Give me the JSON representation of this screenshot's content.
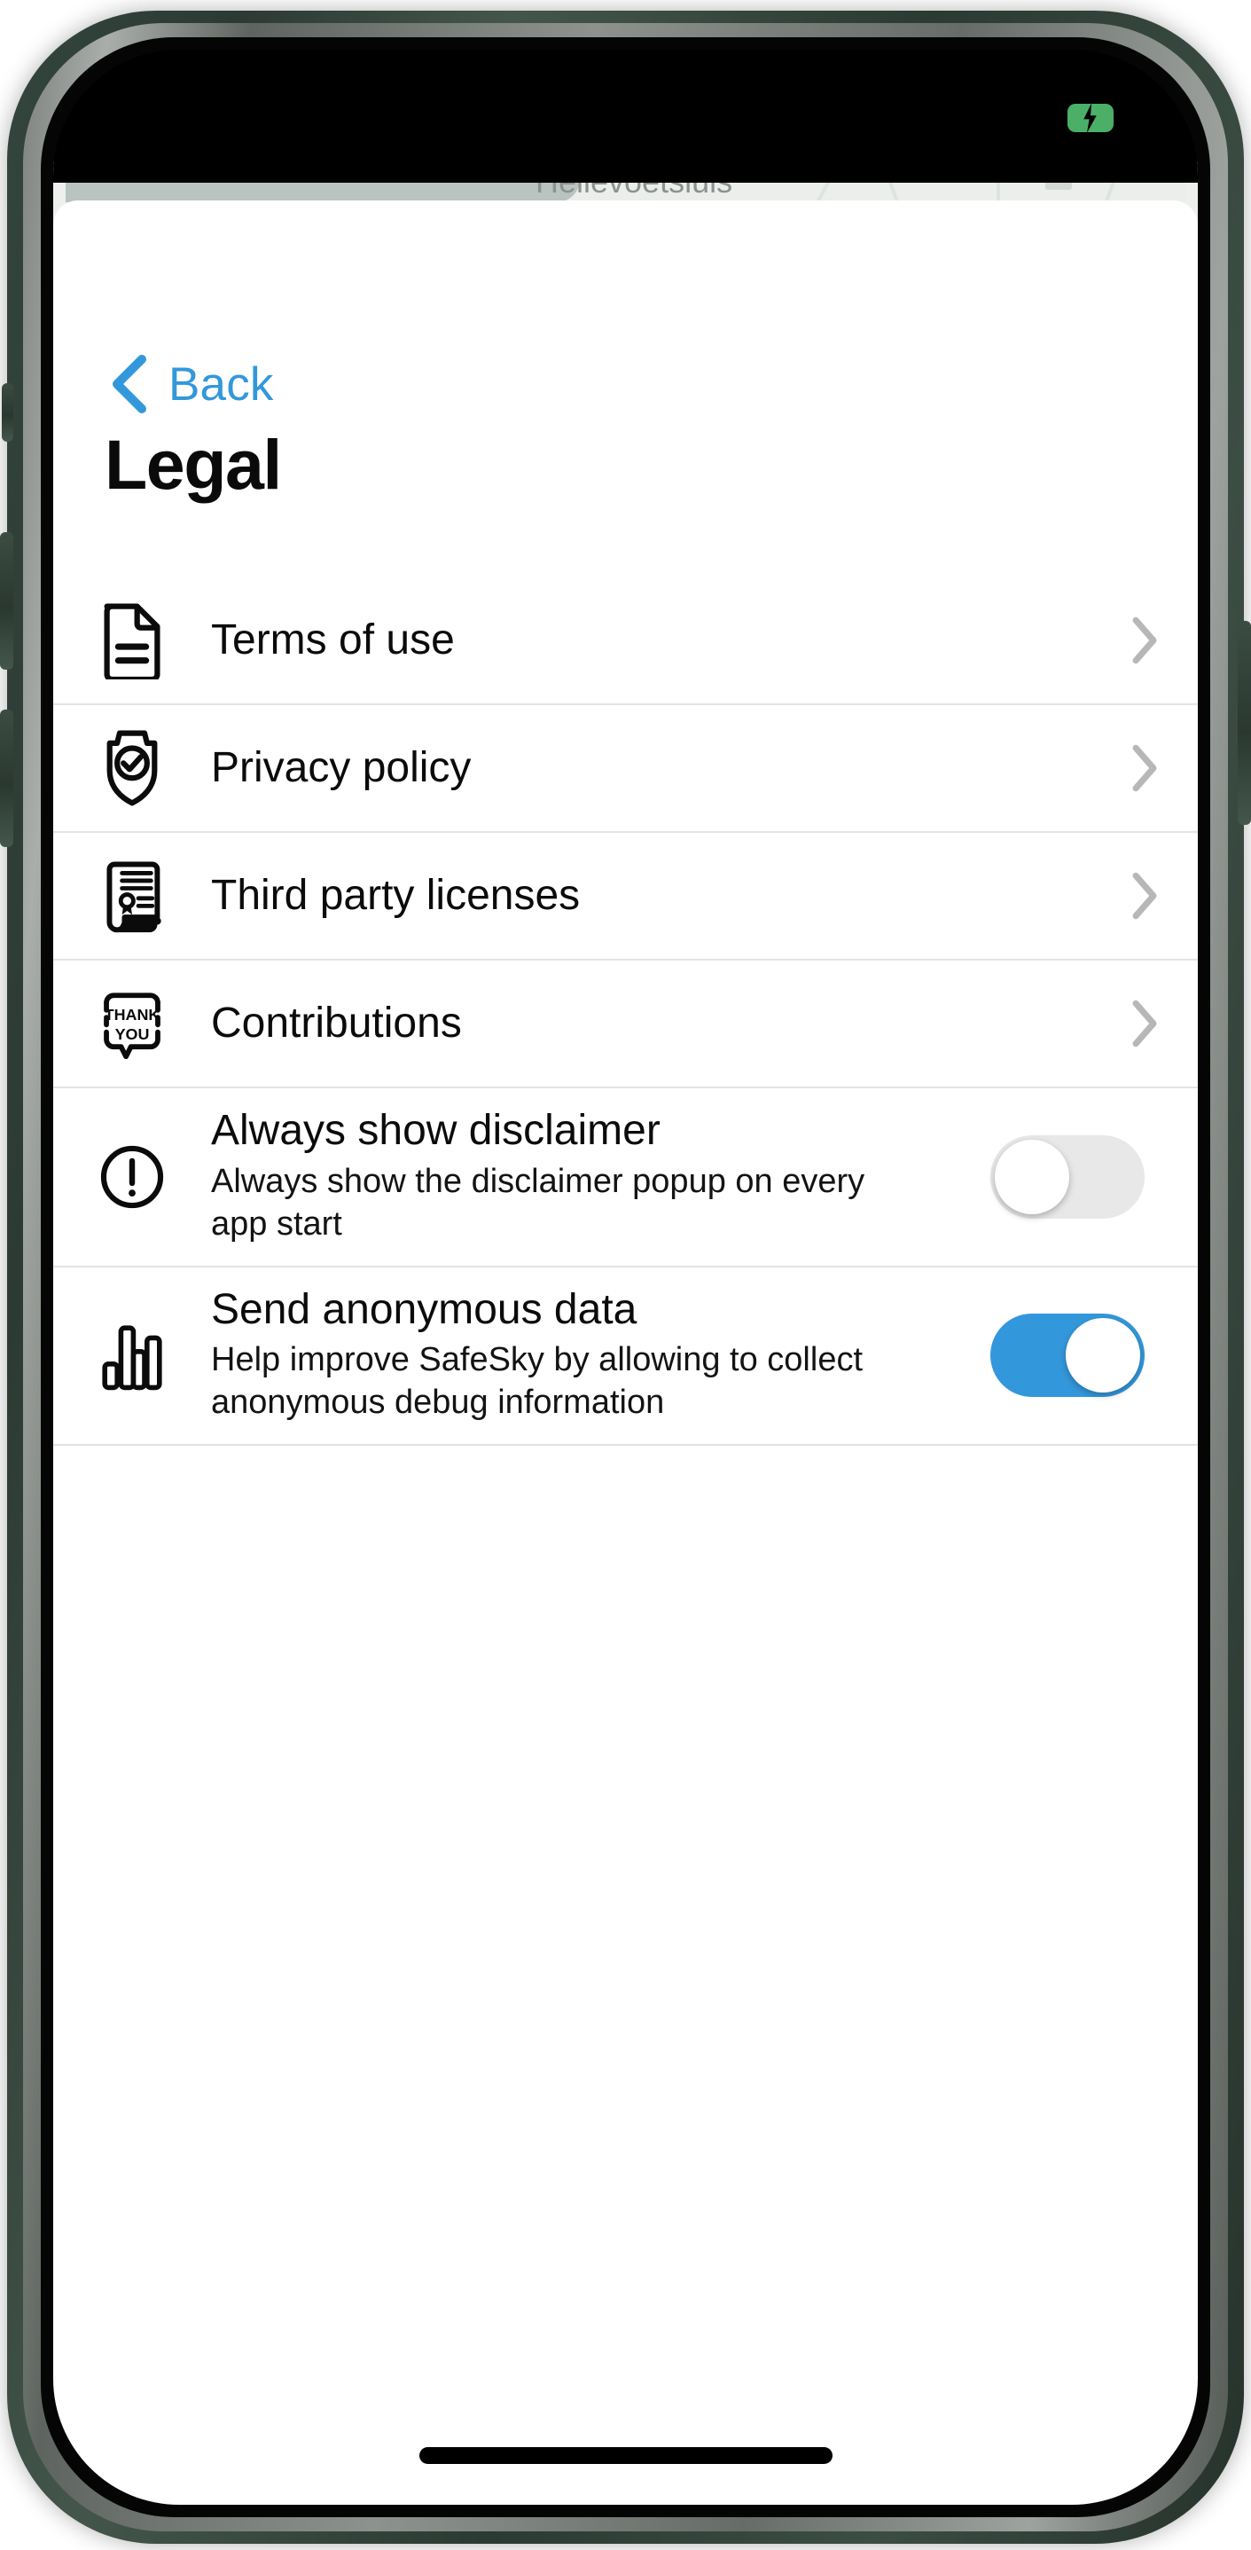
{
  "status_bar": {
    "battery_icon": "battery-charging-icon",
    "battery_color": "#4caf68"
  },
  "map_background": {
    "place_label": "Hellevoetsluis"
  },
  "sheet": {
    "back": {
      "label": "Back",
      "icon": "chevron-left-icon",
      "color": "#3398db"
    },
    "title": "Legal",
    "nav_items": [
      {
        "label": "Terms of use",
        "icon": "document-icon",
        "chevron": "chevron-right-icon"
      },
      {
        "label": "Privacy policy",
        "icon": "shield-check-icon",
        "chevron": "chevron-right-icon"
      },
      {
        "label": "Third party licenses",
        "icon": "certificate-icon",
        "chevron": "chevron-right-icon"
      },
      {
        "label": "Contributions",
        "icon": "thank-you-icon",
        "chevron": "chevron-right-icon"
      }
    ],
    "toggle_items": [
      {
        "title": "Always show disclaimer",
        "subtitle": "Always show the disclaimer popup on every app start",
        "icon": "exclamation-circle-icon",
        "state": "off",
        "off_color": "#e8e8e8"
      },
      {
        "title": "Send anonymous data",
        "subtitle": "Help improve SafeSky by allowing to collect anonymous debug information",
        "icon": "bar-chart-icon",
        "state": "on",
        "on_color": "#3398db"
      }
    ]
  },
  "home_indicator": "home-indicator"
}
